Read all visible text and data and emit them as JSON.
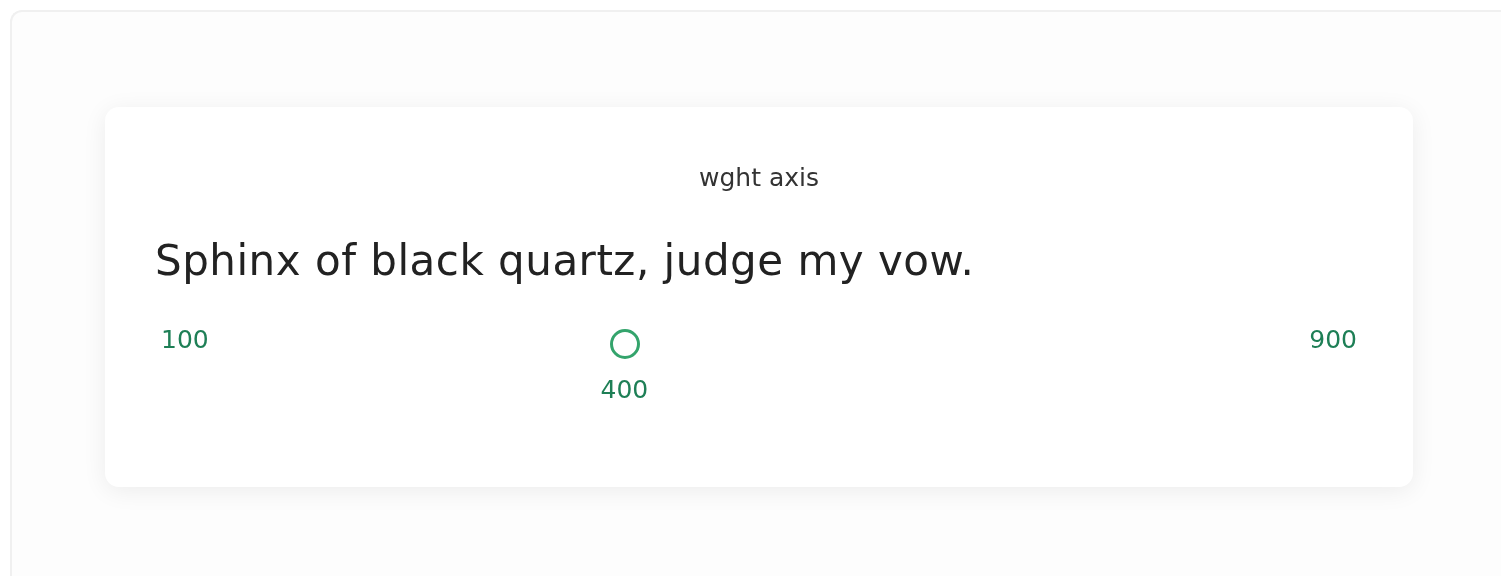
{
  "card": {
    "title": "wght axis",
    "sample": "Sphinx of black quartz, judge my vow."
  },
  "slider": {
    "min_label": "100",
    "max_label": "900",
    "value_label": "400",
    "level": 0.375
  }
}
